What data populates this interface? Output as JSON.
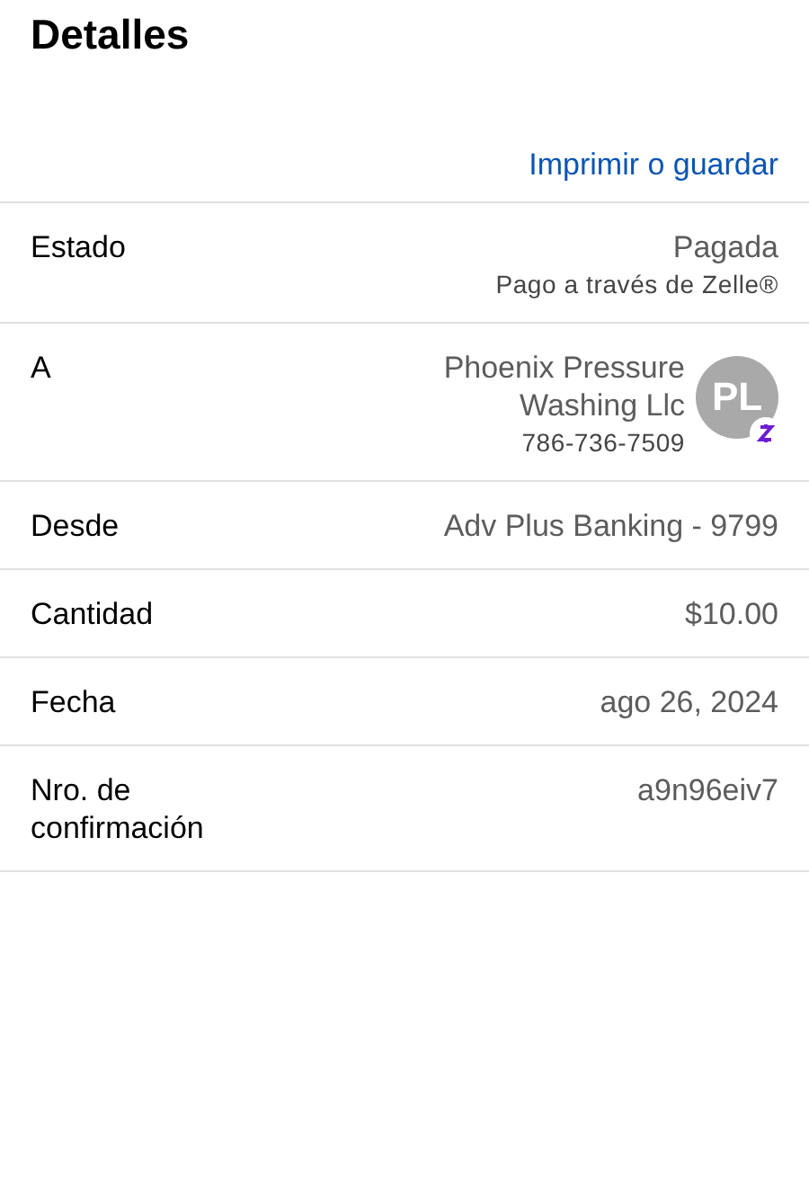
{
  "title": "Detalles",
  "action": "Imprimir o guardar",
  "rows": [
    {
      "kind": "status",
      "label": "Estado",
      "value": "Pagada",
      "note": "Pago a través de Zelle®"
    },
    {
      "kind": "contact",
      "label": "A",
      "value": "Phoenix Pressure Washing Llc",
      "note": "786-736-7509",
      "initials": "PL"
    },
    {
      "kind": "plain",
      "label": "Desde",
      "value": "Adv Plus Banking - 9799"
    },
    {
      "kind": "plain",
      "label": "Cantidad",
      "value": "$10.00"
    },
    {
      "kind": "plain",
      "label": "Fecha",
      "value": "ago 26, 2024"
    },
    {
      "kind": "plain",
      "label": "Nro. de confirmación",
      "value": "a9n96eiv7"
    }
  ]
}
